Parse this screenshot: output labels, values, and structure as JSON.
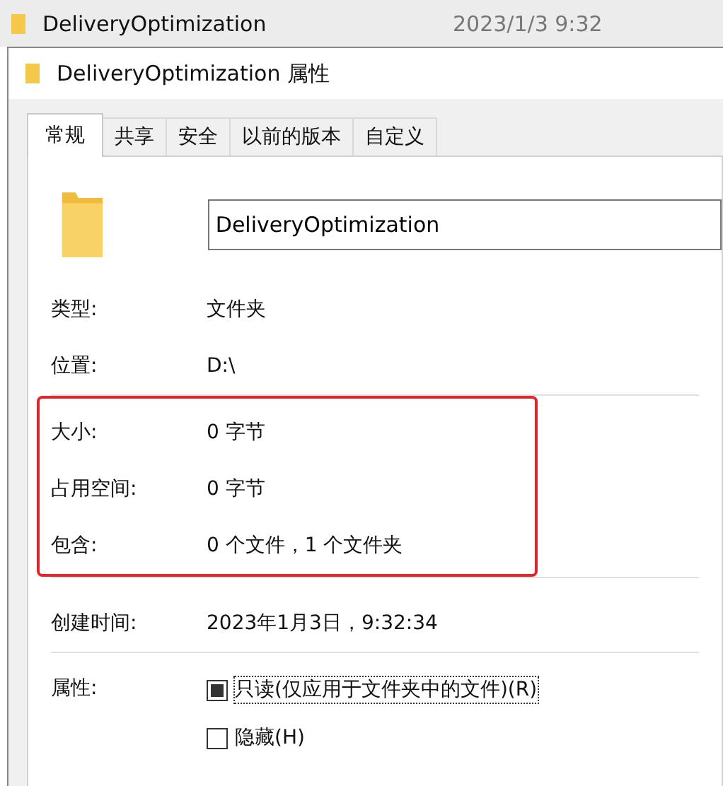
{
  "explorer_row": {
    "name": "DeliveryOptimization",
    "date": "2023/1/3 9:32"
  },
  "window": {
    "title": "DeliveryOptimization 属性"
  },
  "tabs": [
    {
      "label": "常规",
      "selected": true
    },
    {
      "label": "共享",
      "selected": false
    },
    {
      "label": "安全",
      "selected": false
    },
    {
      "label": "以前的版本",
      "selected": false
    },
    {
      "label": "自定义",
      "selected": false
    }
  ],
  "name_field": {
    "value": "DeliveryOptimization"
  },
  "groups": [
    {
      "highlighted": false,
      "rows": [
        {
          "label": "类型:",
          "value": "文件夹"
        },
        {
          "label": "位置:",
          "value": "D:\\"
        }
      ]
    },
    {
      "highlighted": true,
      "rows": [
        {
          "label": "大小:",
          "value": "0 字节"
        },
        {
          "label": "占用空间:",
          "value": "0 字节"
        },
        {
          "label": "包含:",
          "value": "0 个文件，1 个文件夹"
        }
      ]
    },
    {
      "highlighted": false,
      "rows": [
        {
          "label": "创建时间:",
          "value": "2023年1月3日，9:32:34"
        }
      ]
    }
  ],
  "attributes": {
    "label": "属性:",
    "options": [
      {
        "label": "只读(仅应用于文件夹中的文件)(R)",
        "checked": false,
        "indeterminate": true,
        "focused": true
      },
      {
        "label": "隐藏(H)",
        "checked": false,
        "indeterminate": false,
        "focused": false
      }
    ]
  }
}
